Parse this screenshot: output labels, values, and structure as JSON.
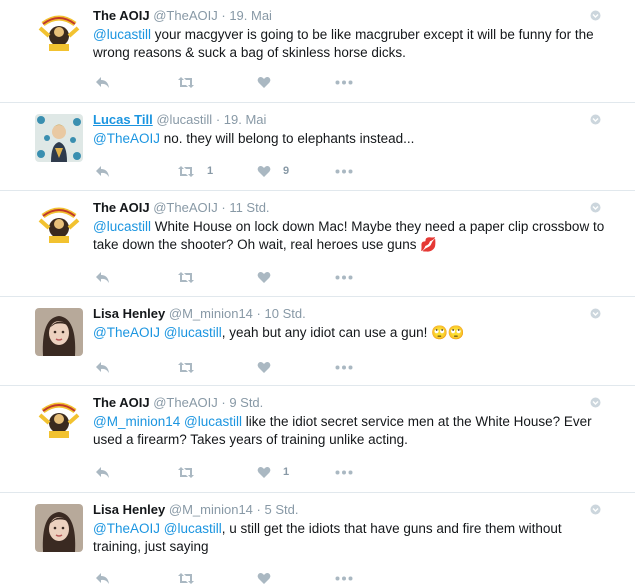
{
  "tweets": [
    {
      "avatar": "aoij-logo",
      "name": "The AOIJ",
      "handle": "@TheAOIJ",
      "dot": "·",
      "time": "19. Mai",
      "mentions": [
        "@lucastill"
      ],
      "text": " your macgyver is going to be like macgruber except it will be funny for the wrong reasons & suck a bag of skinless horse dicks.",
      "retweets": "",
      "likes": ""
    },
    {
      "avatar": "lucas-photo",
      "name": "Lucas Till",
      "handle": "@lucastill",
      "dot": "·",
      "time": "19. Mai",
      "mentions": [
        "@TheAOIJ"
      ],
      "text": " no. they will belong to elephants instead...",
      "retweets": "1",
      "likes": "9"
    },
    {
      "avatar": "aoij-logo",
      "name": "The AOIJ",
      "handle": "@TheAOIJ",
      "dot": "·",
      "time": "11 Std.",
      "mentions": [
        "@lucastill"
      ],
      "text": " White House on lock down Mac!   Maybe they need a paper clip crossbow to take down the shooter?  Oh wait, real heroes use guns 💋",
      "retweets": "",
      "likes": ""
    },
    {
      "avatar": "lisa-photo",
      "name": "Lisa Henley",
      "handle": "@M_minion14",
      "dot": "·",
      "time": "10 Std.",
      "mentions": [
        "@TheAOIJ",
        "@lucastill"
      ],
      "text": ", yeah but any idiot can use a gun! 🙄🙄",
      "retweets": "",
      "likes": ""
    },
    {
      "avatar": "aoij-logo",
      "name": "The AOIJ",
      "handle": "@TheAOIJ",
      "dot": "·",
      "time": "9 Std.",
      "mentions": [
        "@M_minion14",
        "@lucastill"
      ],
      "text": " like the idiot secret service men at the White House? Ever used a firearm?  Takes years of training unlike acting.",
      "retweets": "",
      "likes": "1"
    },
    {
      "avatar": "lisa-photo",
      "name": "Lisa Henley",
      "handle": "@M_minion14",
      "dot": "·",
      "time": "5 Std.",
      "mentions": [
        "@TheAOIJ",
        "@lucastill"
      ],
      "text": ", u still get the idiots that have guns and fire them without training, just saying",
      "retweets": "",
      "likes": ""
    }
  ],
  "icons": {
    "reply": "reply-icon",
    "retweet": "retweet-icon",
    "like": "heart-icon",
    "more": "more-icon",
    "caret": "caret-icon"
  },
  "colors": {
    "link": "#1b95e0",
    "muted": "#8899a6",
    "icon": "#aab8c2",
    "border": "#e1e8ed"
  }
}
